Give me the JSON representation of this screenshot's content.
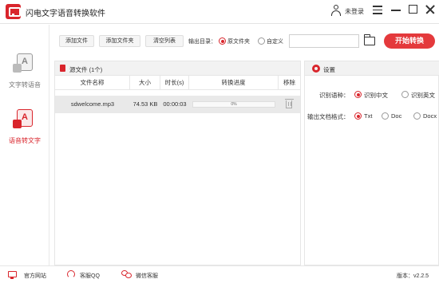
{
  "app": {
    "title": "闪电文字语音转换软件",
    "login": "未登录"
  },
  "sidebar": {
    "items": [
      {
        "label": "文字转语音",
        "icon_text": "A"
      },
      {
        "label": "语音转文字",
        "icon_text": "A"
      }
    ]
  },
  "toolbar": {
    "add_file": "添加文件",
    "add_folder": "添加文件夹",
    "clear_list": "清空列表",
    "output_dir_label": "输出目录：",
    "output_options": [
      "原文件夹",
      "自定义"
    ],
    "output_selected": "原文件夹",
    "path_value": "",
    "start": "开始转换"
  },
  "file_panel": {
    "title": "源文件 (1个)",
    "columns": [
      "文件名称",
      "大小",
      "时长(s)",
      "转换进度",
      "移除"
    ],
    "rows": [
      {
        "name": "sdwelcome.mp3",
        "size": "74.53 KB",
        "duration": "00:00:03",
        "progress": "0%",
        "progress_value": 0
      }
    ]
  },
  "settings": {
    "title": "设置",
    "language_label": "识别语种：",
    "language_options": [
      "识别中文",
      "识别英文"
    ],
    "language_selected": "识别中文",
    "format_label": "输出文档格式：",
    "format_options": [
      "Txt",
      "Doc",
      "Docx"
    ],
    "format_selected": "Txt"
  },
  "footer": {
    "website": "官方网站",
    "qq": "客服QQ",
    "wechat": "微信客服",
    "version": "版本：v2.2.5"
  },
  "colors": {
    "accent": "#e4393c",
    "brand_red": "#d9252c"
  }
}
